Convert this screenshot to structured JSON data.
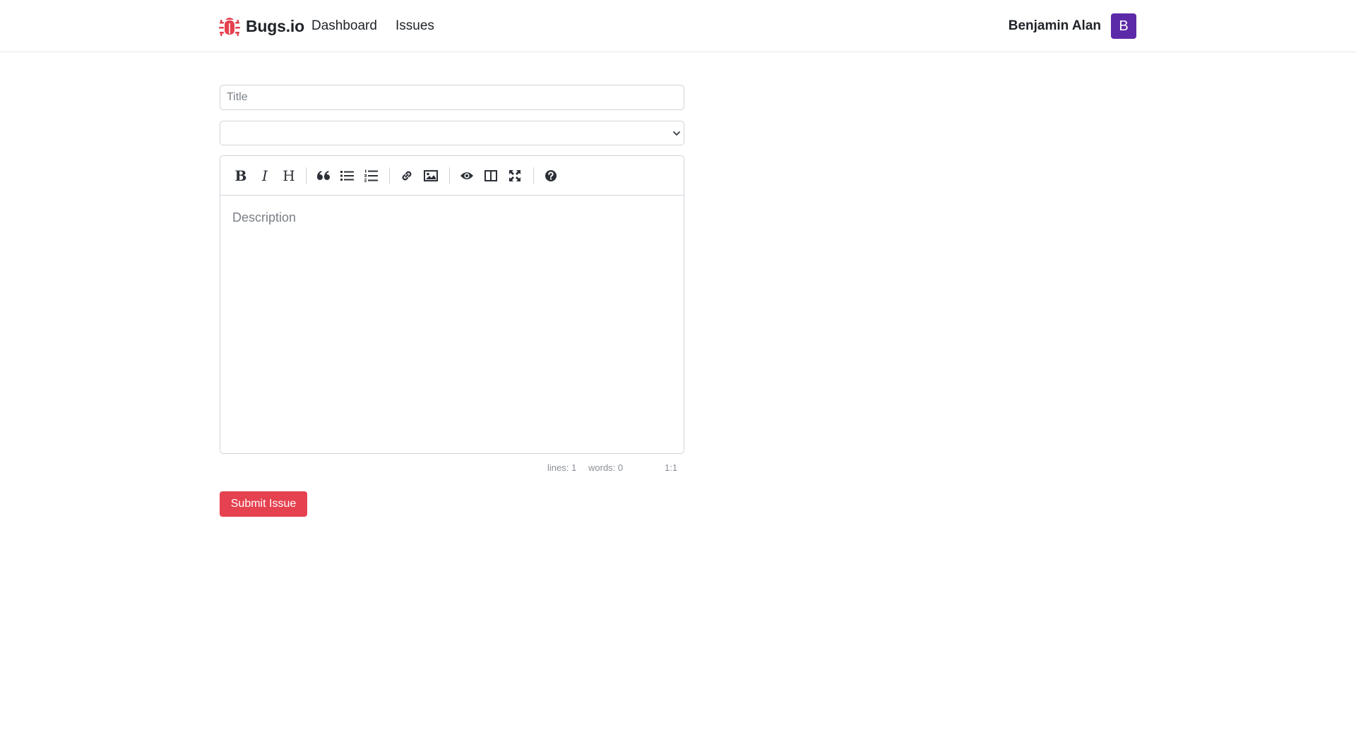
{
  "navbar": {
    "brand": "Bugs.io",
    "links": [
      "Dashboard",
      "Issues"
    ],
    "user_name": "Benjamin Alan",
    "avatar_initial": "B",
    "brand_color": "#e5414f",
    "avatar_color": "#5b2aa8"
  },
  "form": {
    "title_placeholder": "Title",
    "title_value": "",
    "select_value": "",
    "toolbar": [
      {
        "icon": "bold-icon",
        "glyph": "B"
      },
      {
        "icon": "italic-icon",
        "glyph": "I"
      },
      {
        "icon": "heading-icon",
        "glyph": "H"
      },
      {
        "icon": "quote-icon"
      },
      {
        "icon": "unordered-list-icon"
      },
      {
        "icon": "ordered-list-icon"
      },
      {
        "icon": "link-icon"
      },
      {
        "icon": "image-icon"
      },
      {
        "icon": "preview-icon"
      },
      {
        "icon": "side-by-side-icon"
      },
      {
        "icon": "fullscreen-icon"
      },
      {
        "icon": "help-icon"
      }
    ],
    "description_placeholder": "Description",
    "status": {
      "lines": "lines: 1",
      "words": "words: 0",
      "cursor": "1:1"
    },
    "submit_label": "Submit Issue"
  }
}
